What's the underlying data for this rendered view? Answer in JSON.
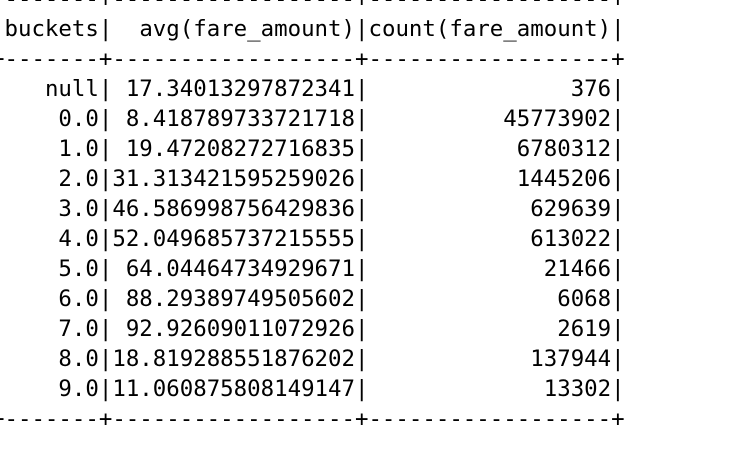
{
  "table": {
    "columns": [
      "buckets",
      "avg(fare_amount)",
      "count(fare_amount)"
    ],
    "rows": [
      [
        "null",
        "17.34013297872341",
        "376"
      ],
      [
        "0.0",
        "8.418789733721718",
        "45773902"
      ],
      [
        "1.0",
        "19.47208272716835",
        "6780312"
      ],
      [
        "2.0",
        "31.313421595259026",
        "1445206"
      ],
      [
        "3.0",
        "46.586998756429836",
        "629639"
      ],
      [
        "4.0",
        "52.049685737215555",
        "613022"
      ],
      [
        "5.0",
        "64.04464734929671",
        "21466"
      ],
      [
        "6.0",
        "88.29389749505602",
        "6068"
      ],
      [
        "7.0",
        "92.92609011072926",
        "2619"
      ],
      [
        "8.0",
        "18.819288551876202",
        "137944"
      ],
      [
        "9.0",
        "11.060875808149147",
        "13302"
      ]
    ]
  }
}
